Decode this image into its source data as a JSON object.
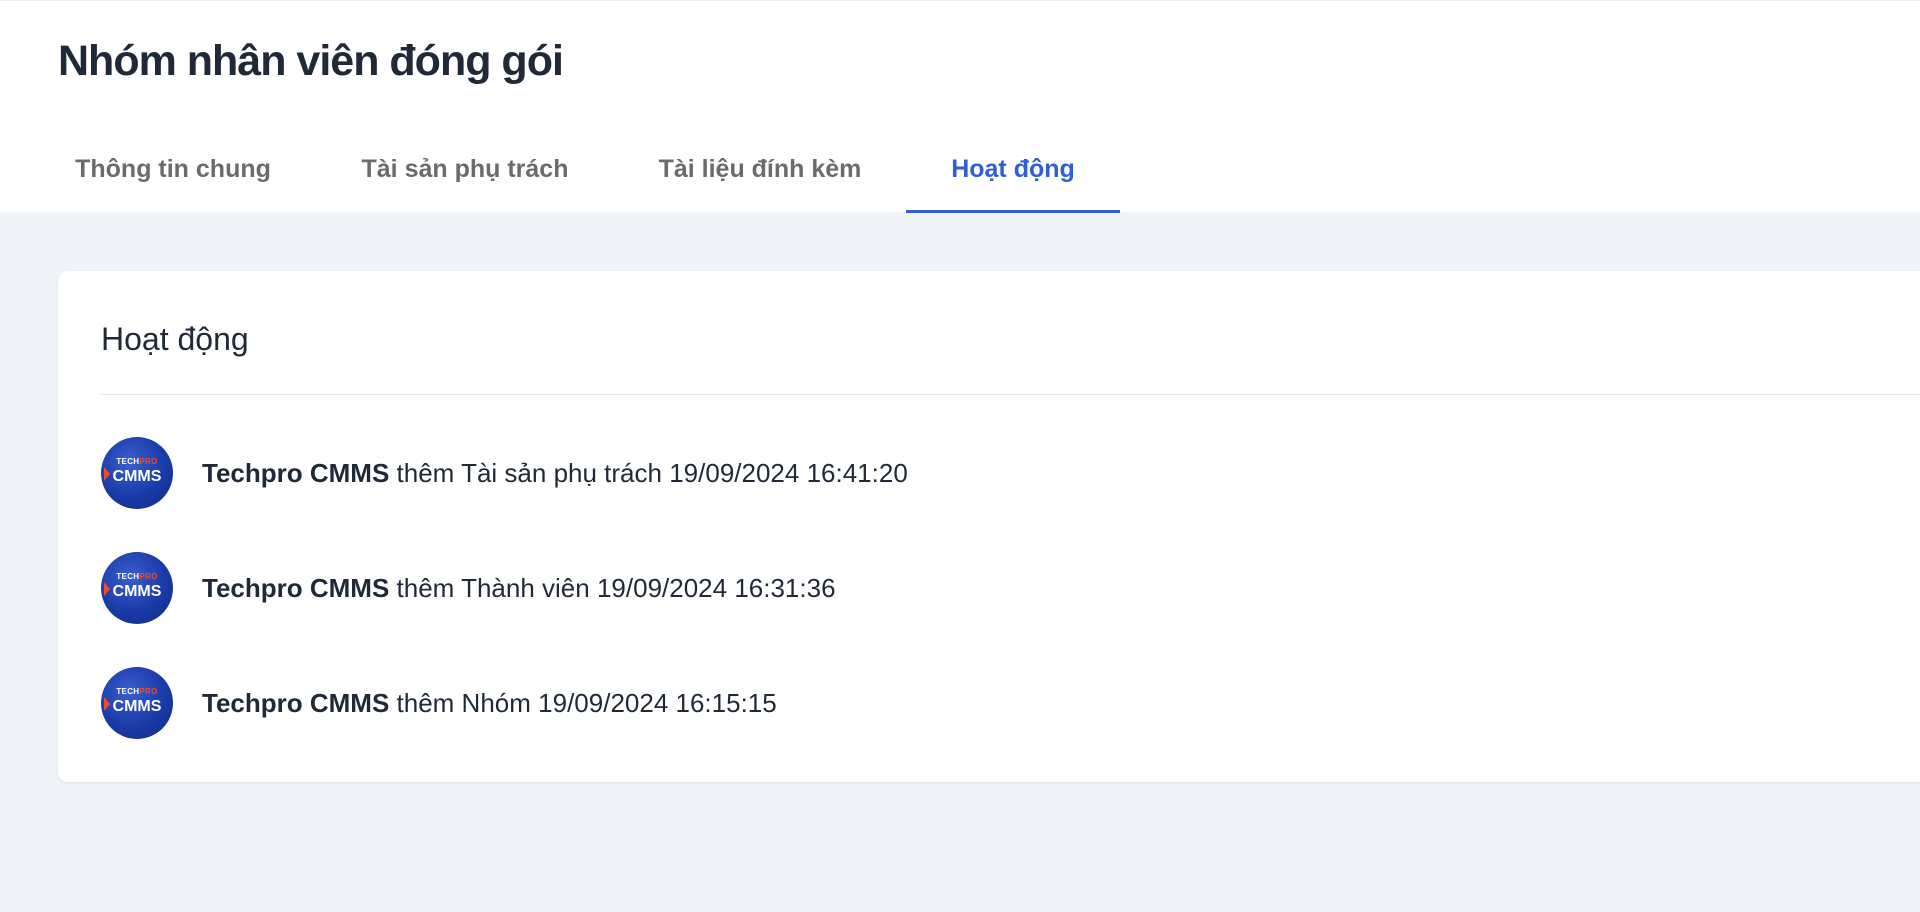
{
  "page": {
    "title": "Nhóm nhân viên đóng gói"
  },
  "tabs": [
    {
      "label": "Thông tin chung",
      "active": false
    },
    {
      "label": "Tài sản phụ trách",
      "active": false
    },
    {
      "label": "Tài liệu đính kèm",
      "active": false
    },
    {
      "label": "Hoạt động",
      "active": true
    }
  ],
  "activity_card": {
    "title": "Hoạt động",
    "items": [
      {
        "actor": "Techpro CMMS",
        "action": "thêm Tài sản phụ trách",
        "timestamp": "19/09/2024 16:41:20"
      },
      {
        "actor": "Techpro CMMS",
        "action": "thêm Thành viên",
        "timestamp": "19/09/2024 16:31:36"
      },
      {
        "actor": "Techpro CMMS",
        "action": "thêm Nhóm",
        "timestamp": "19/09/2024 16:15:15"
      }
    ]
  },
  "avatar": {
    "brand_top_a": "TECH",
    "brand_top_b": "PRO",
    "brand_main": "CMMS"
  },
  "colors": {
    "accent": "#2f5ed8",
    "page_bg": "#f0f3f8",
    "avatar_blue": "#1a3aa6",
    "brand_orange": "#f04a2c"
  }
}
